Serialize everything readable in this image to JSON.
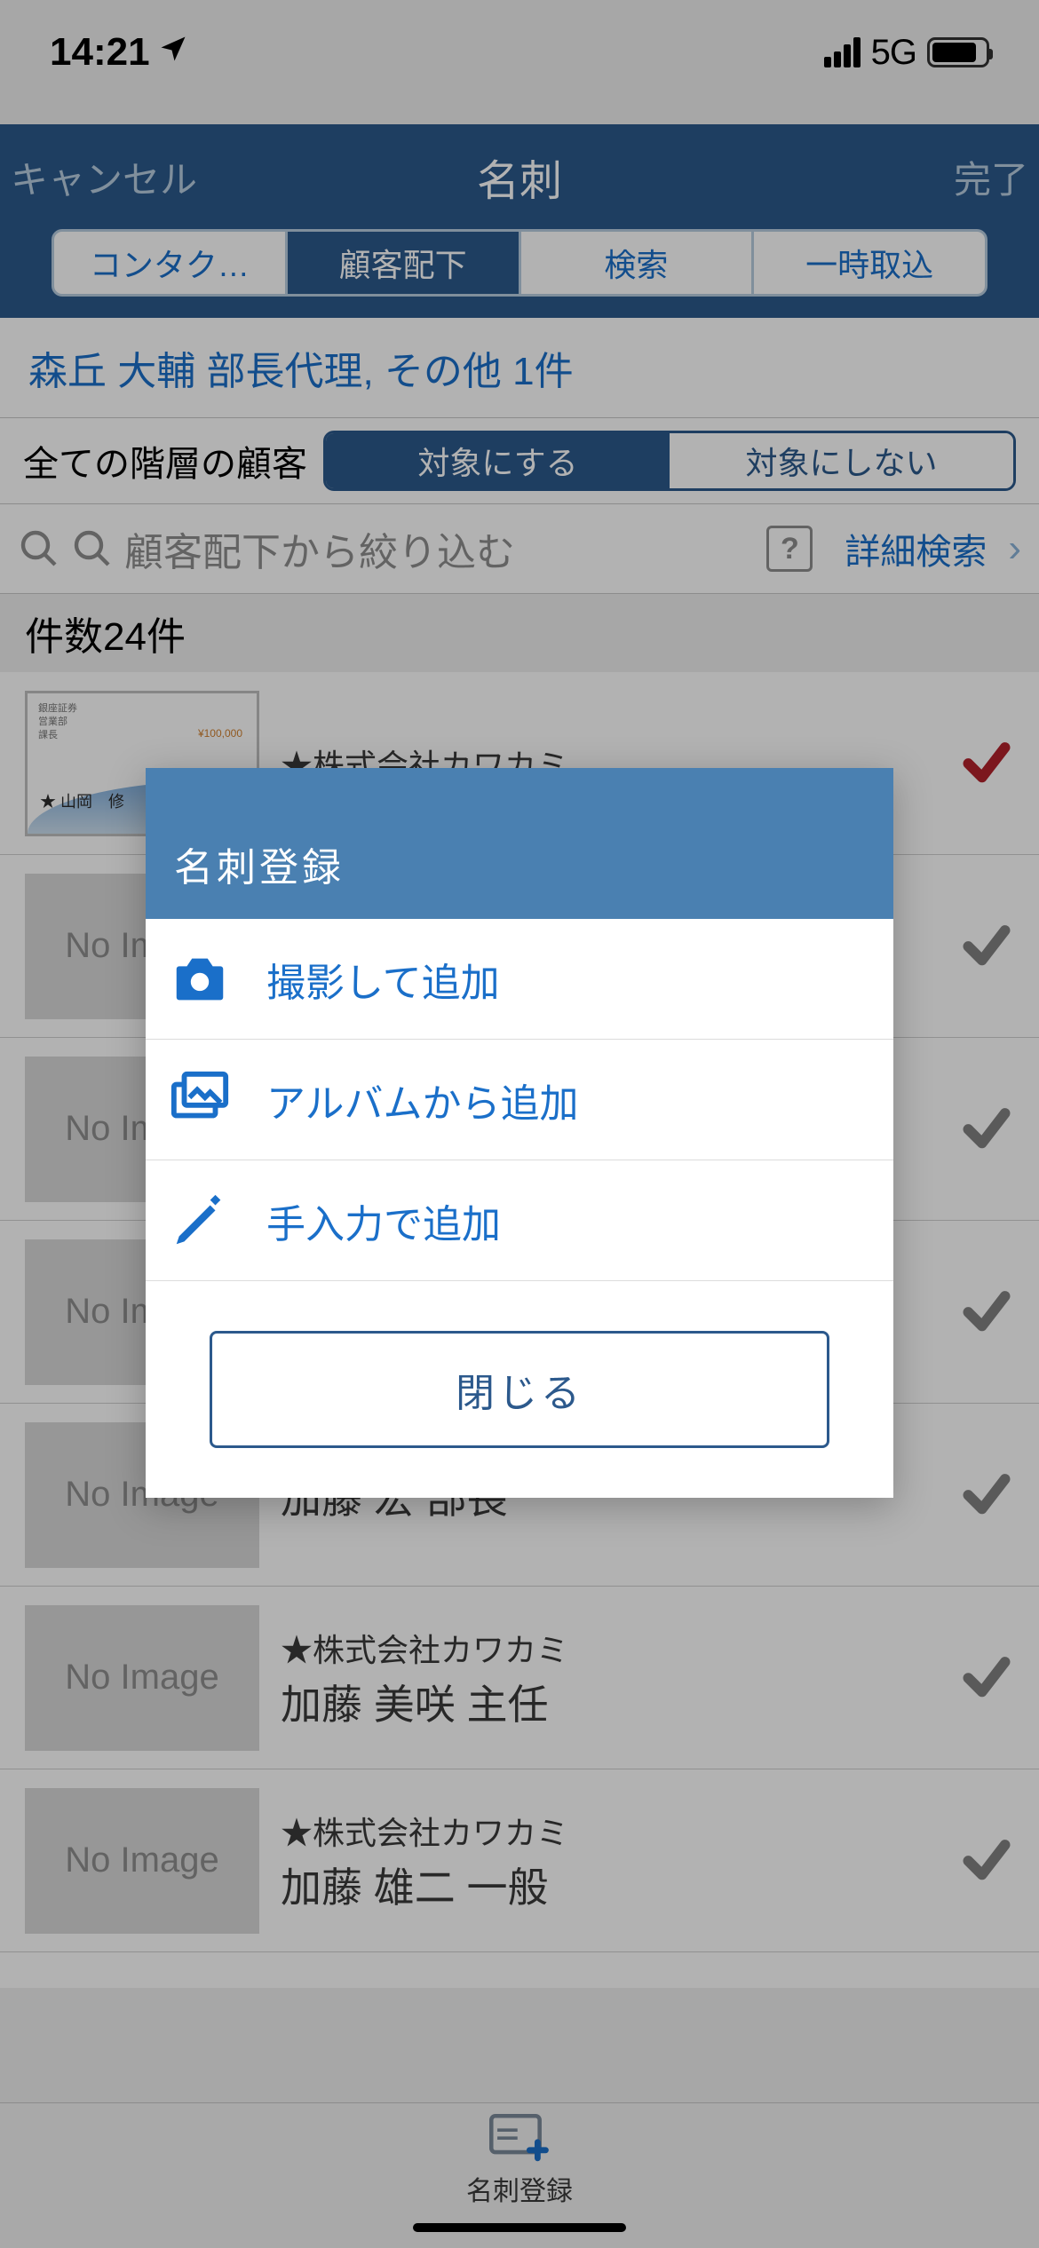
{
  "statusbar": {
    "time": "14:21",
    "net": "5G"
  },
  "nav": {
    "cancel": "キャンセル",
    "title": "名刺",
    "done": "完了"
  },
  "tabs": [
    "コンタク…",
    "顧客配下",
    "検索",
    "一時取込"
  ],
  "tabs_active_index": 1,
  "selected_bar": "森丘 大輔 部長代理, その他 1件",
  "target": {
    "label": "全ての階層の顧客",
    "on": "対象にする",
    "off": "対象にしない"
  },
  "search": {
    "placeholder": "顧客配下から絞り込む",
    "advanced": "詳細検索"
  },
  "count": "件数24件",
  "no_image_label": "No Image",
  "list": [
    {
      "company": "★株式会社カワカミ",
      "person": "",
      "selected": "red",
      "card": true,
      "card_name": "★ 山岡　修"
    },
    {
      "company": "",
      "person": "",
      "selected": "grey",
      "card": false
    },
    {
      "company": "",
      "person": "",
      "selected": "grey",
      "card": false
    },
    {
      "company": "",
      "person": "",
      "selected": "grey",
      "card": false
    },
    {
      "company": "",
      "person": "加藤 宏 部長",
      "selected": "grey",
      "card": false
    },
    {
      "company": "★株式会社カワカミ",
      "person": "加藤 美咲 主任",
      "selected": "grey",
      "card": false
    },
    {
      "company": "★株式会社カワカミ",
      "person": "加藤 雄二 一般",
      "selected": "grey",
      "card": false
    }
  ],
  "bottombar": {
    "label": "名刺登録"
  },
  "modal": {
    "title": "名刺登録",
    "items": [
      {
        "icon": "camera",
        "label": "撮影して追加"
      },
      {
        "icon": "album",
        "label": "アルバムから追加"
      },
      {
        "icon": "pencil",
        "label": "手入力で追加"
      }
    ],
    "close": "閉じる"
  }
}
